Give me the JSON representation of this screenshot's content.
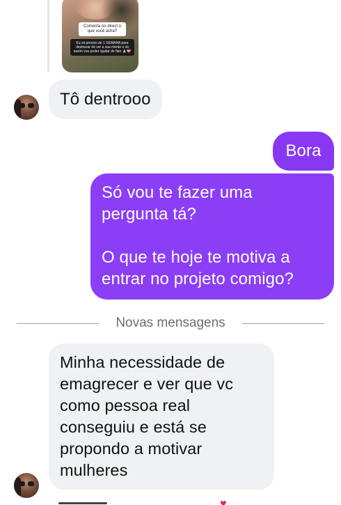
{
  "story_reply": {
    "question": "Comenta no direct o\nque você acha?",
    "answer": "Eu só preciso de 1 SEMANA para\ndestravar de ver a sua mente e só\nassim vou poder ajudar de fato 🙏🏻💝"
  },
  "messages": [
    {
      "direction": "incoming",
      "text": "Tô dentrooo"
    },
    {
      "direction": "outgoing",
      "text": "Bora"
    },
    {
      "direction": "outgoing",
      "text": "Só vou te fazer uma\npergunta tá?\n\nO que te hoje te motiva a\nentrar no projeto comigo?"
    },
    {
      "direction": "incoming",
      "text": "Minha necessidade de\nemagrecer e ver que vc\ncomo pessoa real\nconseguiu e está se\npropondo a motivar\nmulheres"
    }
  ],
  "divider": {
    "label": "Novas mensagens"
  },
  "colors": {
    "outgoing_bubble": "#8b3ef6",
    "incoming_bubble": "#eff1f4",
    "reaction_heart": "#e0245e"
  },
  "icons": {
    "reaction": "heart-icon"
  }
}
